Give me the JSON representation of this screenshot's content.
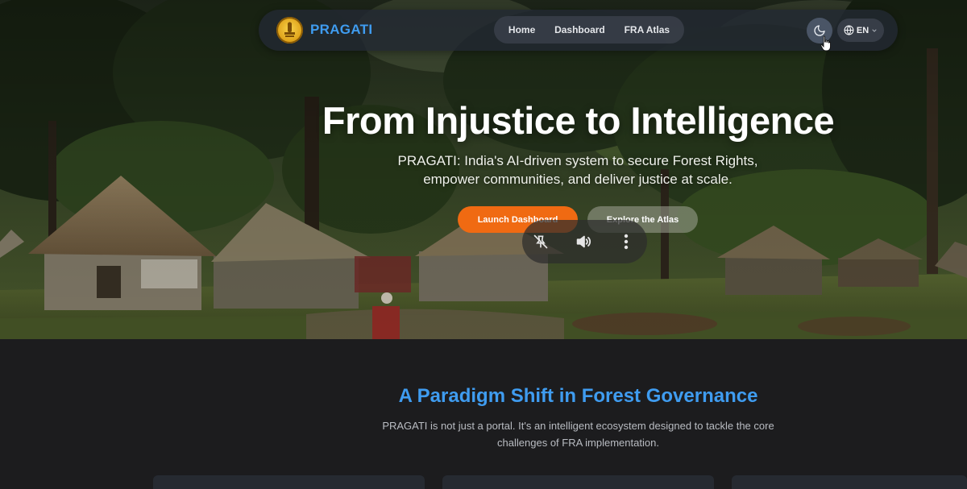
{
  "navbar": {
    "brand": "PRAGATI",
    "emblem_icon": "national-emblem-icon",
    "links": [
      {
        "label": "Home"
      },
      {
        "label": "Dashboard"
      },
      {
        "label": "FRA Atlas"
      }
    ],
    "theme_icon": "moon-icon",
    "language": {
      "icon": "globe-icon",
      "label": "EN",
      "chevron": "chevron-down-icon"
    }
  },
  "hero": {
    "title": "From Injustice to Intelligence",
    "subtitle": "PRAGATI: India's AI-driven system to secure Forest Rights, empower communities, and deliver justice at scale.",
    "primary_cta": "Launch Dashboard",
    "secondary_cta": "Explore the Atlas"
  },
  "media_controls": {
    "icons": [
      "pin-off-icon",
      "volume-icon",
      "more-vertical-icon"
    ]
  },
  "section": {
    "title": "A Paradigm Shift in Forest Governance",
    "description": "PRAGATI is not just a portal. It's an intelligent ecosystem designed to tackle the core challenges of FRA implementation."
  },
  "colors": {
    "brand_blue": "#3f9cf0",
    "cta_orange": "#f06a12",
    "page_bg": "#1c1c1e",
    "navbar_bg": "#222832"
  }
}
